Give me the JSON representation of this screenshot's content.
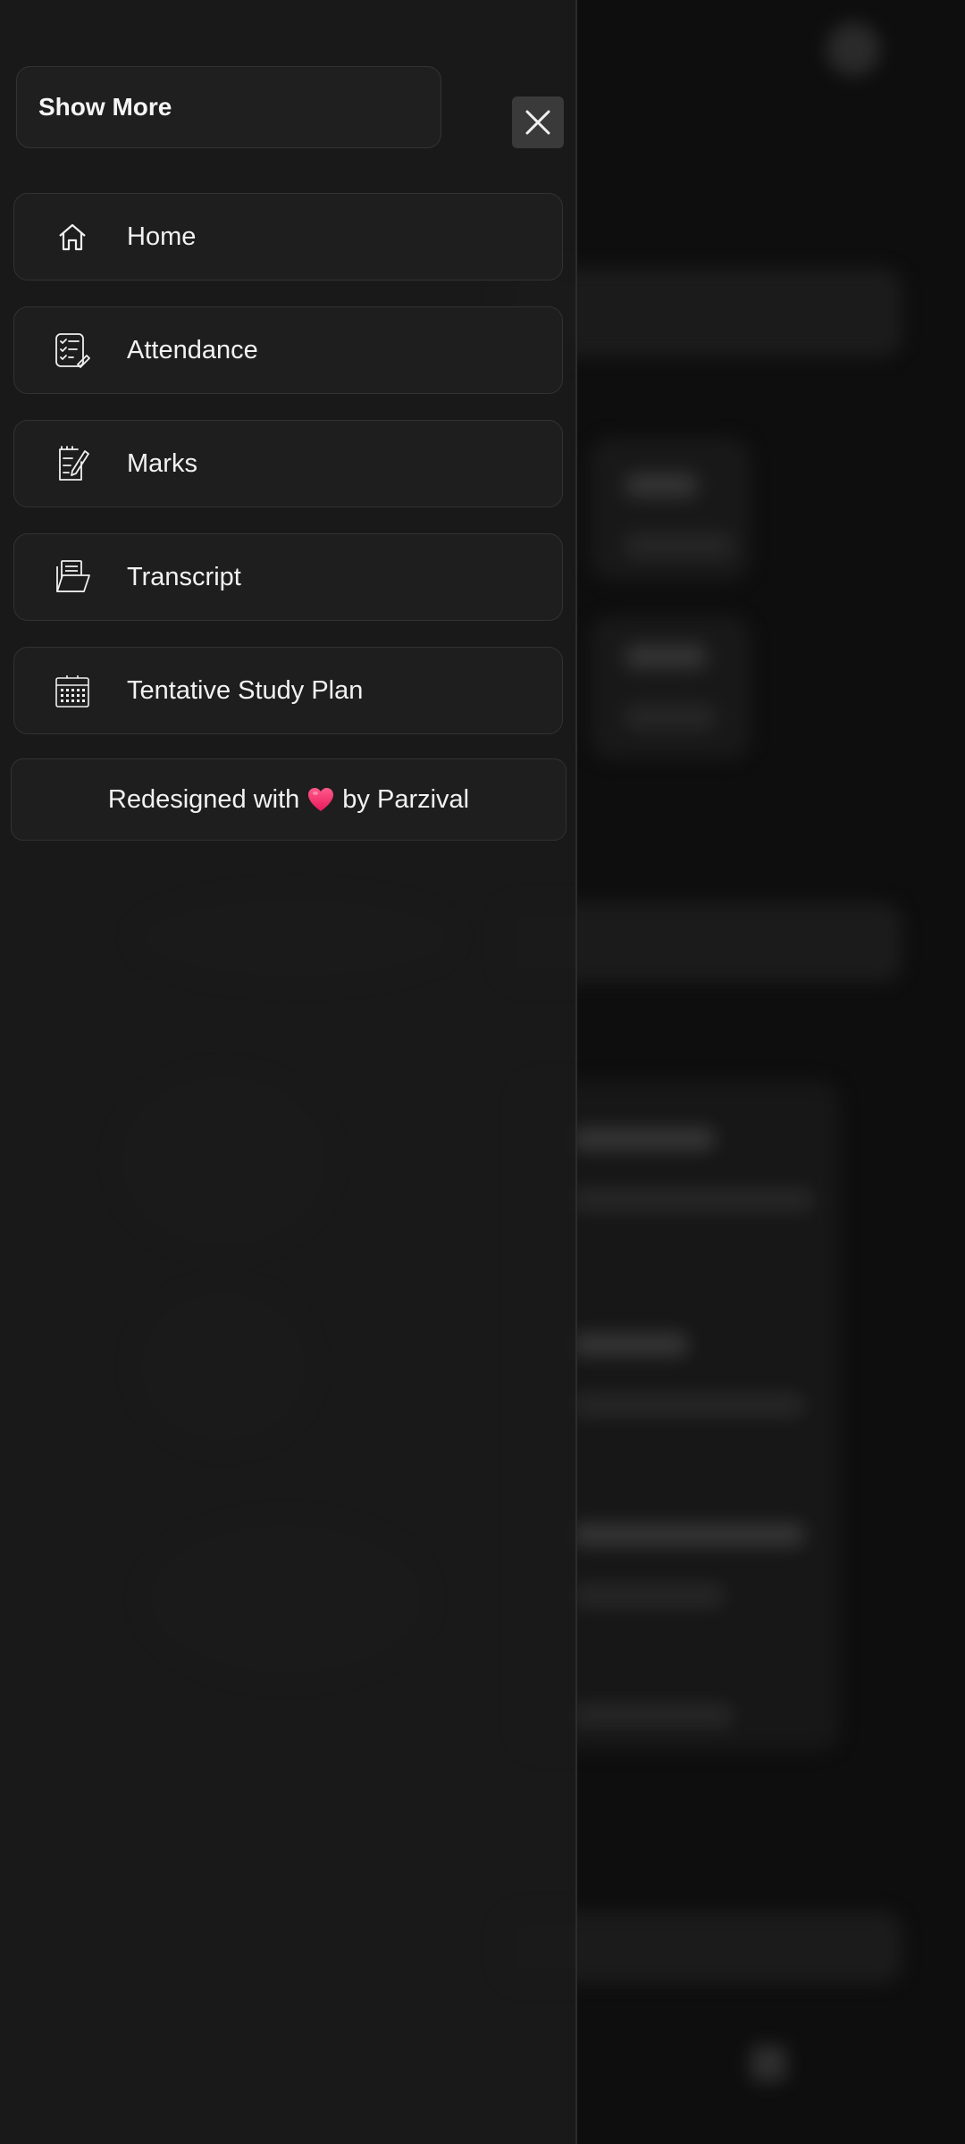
{
  "drawer": {
    "title": "Show More",
    "close_icon": "close-icon",
    "items": [
      {
        "label": "Home",
        "icon": "home-icon"
      },
      {
        "label": "Attendance",
        "icon": "checklist-icon"
      },
      {
        "label": "Marks",
        "icon": "document-edit-icon"
      },
      {
        "label": "Transcript",
        "icon": "folder-document-icon"
      },
      {
        "label": "Tentative Study Plan",
        "icon": "calendar-icon"
      }
    ],
    "footer": {
      "prefix": "Redesigned with",
      "suffix": "by Parzival",
      "heart_color": "#ff3d77"
    }
  }
}
